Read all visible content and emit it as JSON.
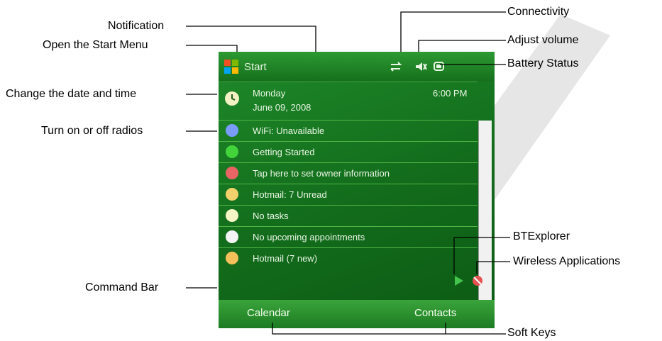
{
  "callouts": {
    "notification": "Notification",
    "open_start_menu": "Open the Start Menu",
    "change_date_time": "Change the date and time",
    "turn_radios": "Turn on or off radios",
    "command_bar": "Command Bar",
    "connectivity": "Connectivity",
    "adjust_volume": "Adjust volume",
    "battery_status": "Battery Status",
    "btexplorer": "BTExplorer",
    "wireless_applications": "Wireless Applications",
    "soft_keys": "Soft Keys"
  },
  "device": {
    "start_label": "Start",
    "day": "Monday",
    "date": "June 09, 2008",
    "time": "6:00 PM",
    "rows": [
      "WiFi: Unavailable",
      "Getting Started",
      "Tap here to set owner information",
      "Hotmail: 7 Unread",
      "No tasks",
      "No upcoming appointments",
      "Hotmail (7 new)"
    ],
    "softkeys": {
      "left": "Calendar",
      "right": "Contacts"
    }
  },
  "colors": {
    "screen_green": "#1f8a2a",
    "softkey_bar": "#2a9430"
  }
}
